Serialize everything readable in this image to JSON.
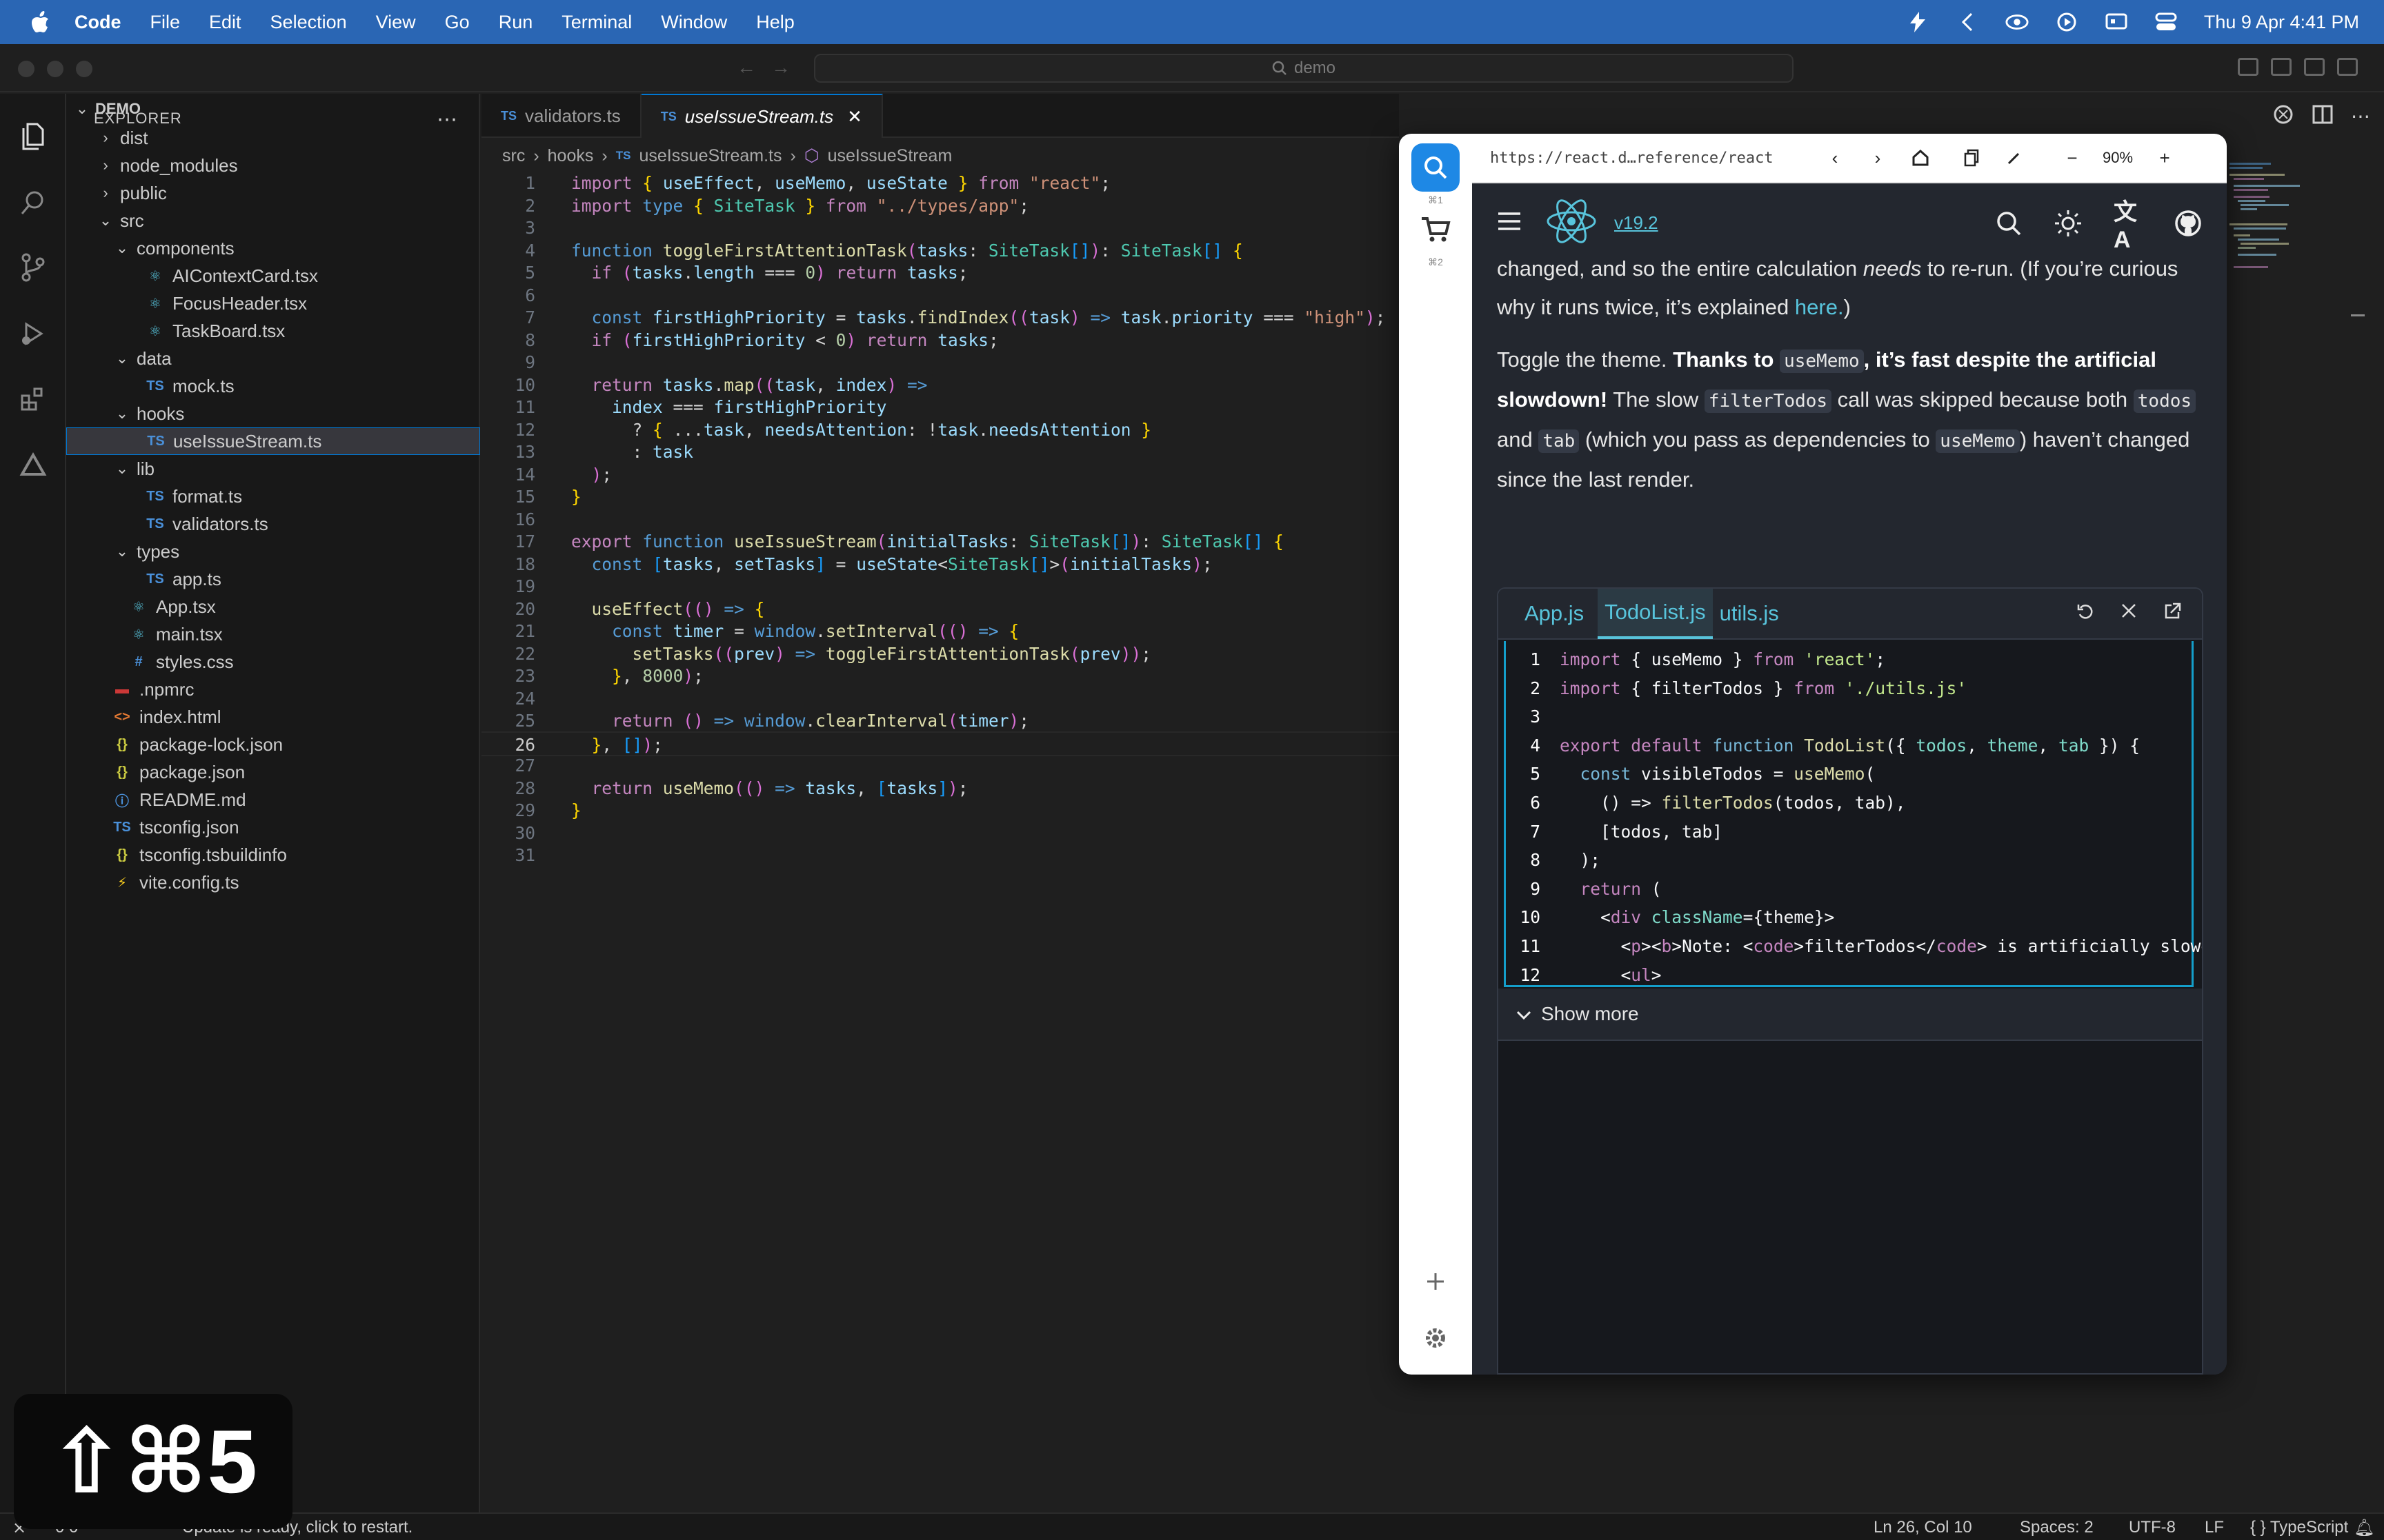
{
  "menubar": {
    "app": "Code",
    "items": [
      "File",
      "Edit",
      "Selection",
      "View",
      "Go",
      "Run",
      "Terminal",
      "Window",
      "Help"
    ],
    "clock": "Thu 9 Apr  4:41 PM"
  },
  "titlebar": {
    "search": "demo"
  },
  "explorer": {
    "title": "EXPLORER",
    "root": "DEMO",
    "tree": [
      {
        "label": "dist",
        "depth": 1,
        "kind": "folder",
        "open": false
      },
      {
        "label": "node_modules",
        "depth": 1,
        "kind": "folder",
        "open": false
      },
      {
        "label": "public",
        "depth": 1,
        "kind": "folder",
        "open": false
      },
      {
        "label": "src",
        "depth": 1,
        "kind": "folder",
        "open": true
      },
      {
        "label": "components",
        "depth": 2,
        "kind": "folder",
        "open": true
      },
      {
        "label": "AIContextCard.tsx",
        "depth": 3,
        "kind": "react"
      },
      {
        "label": "FocusHeader.tsx",
        "depth": 3,
        "kind": "react"
      },
      {
        "label": "TaskBoard.tsx",
        "depth": 3,
        "kind": "react"
      },
      {
        "label": "data",
        "depth": 2,
        "kind": "folder",
        "open": true
      },
      {
        "label": "mock.ts",
        "depth": 3,
        "kind": "ts"
      },
      {
        "label": "hooks",
        "depth": 2,
        "kind": "folder",
        "open": true
      },
      {
        "label": "useIssueStream.ts",
        "depth": 3,
        "kind": "ts",
        "selected": true
      },
      {
        "label": "lib",
        "depth": 2,
        "kind": "folder",
        "open": true
      },
      {
        "label": "format.ts",
        "depth": 3,
        "kind": "ts"
      },
      {
        "label": "validators.ts",
        "depth": 3,
        "kind": "ts"
      },
      {
        "label": "types",
        "depth": 2,
        "kind": "folder",
        "open": true
      },
      {
        "label": "app.ts",
        "depth": 3,
        "kind": "ts"
      },
      {
        "label": "App.tsx",
        "depth": 2,
        "kind": "react"
      },
      {
        "label": "main.tsx",
        "depth": 2,
        "kind": "react"
      },
      {
        "label": "styles.css",
        "depth": 2,
        "kind": "css"
      },
      {
        "label": ".npmrc",
        "depth": 1,
        "kind": "npm"
      },
      {
        "label": "index.html",
        "depth": 1,
        "kind": "html"
      },
      {
        "label": "package-lock.json",
        "depth": 1,
        "kind": "json"
      },
      {
        "label": "package.json",
        "depth": 1,
        "kind": "json"
      },
      {
        "label": "README.md",
        "depth": 1,
        "kind": "info"
      },
      {
        "label": "tsconfig.json",
        "depth": 1,
        "kind": "tsconfig"
      },
      {
        "label": "tsconfig.tsbuildinfo",
        "depth": 1,
        "kind": "json"
      },
      {
        "label": "vite.config.ts",
        "depth": 1,
        "kind": "vite"
      }
    ]
  },
  "tabs": [
    {
      "label": "validators.ts",
      "badge": "TS",
      "active": false
    },
    {
      "label": "useIssueStream.ts",
      "badge": "TS",
      "active": true
    }
  ],
  "breadcrumb": [
    "src",
    "hooks",
    "useIssueStream.ts",
    "useIssueStream"
  ],
  "code": {
    "current_line": 26,
    "lines": [
      "import { useEffect, useMemo, useState } from \"react\";",
      "import type { SiteTask } from \"../types/app\";",
      "",
      "function toggleFirstAttentionTask(tasks: SiteTask[]): SiteTask[] {",
      "  if (tasks.length === 0) return tasks;",
      "",
      "  const firstHighPriority = tasks.findIndex((task) => task.priority === \"high\");",
      "  if (firstHighPriority < 0) return tasks;",
      "",
      "  return tasks.map((task, index) =>",
      "    index === firstHighPriority",
      "      ? { ...task, needsAttention: !task.needsAttention }",
      "      : task",
      "  );",
      "}",
      "",
      "export function useIssueStream(initialTasks: SiteTask[]): SiteTask[] {",
      "  const [tasks, setTasks] = useState<SiteTask[]>(initialTasks);",
      "",
      "  useEffect(() => {",
      "    const timer = window.setInterval(() => {",
      "      setTasks((prev) => toggleFirstAttentionTask(prev));",
      "    }, 8000);",
      "",
      "    return () => window.clearInterval(timer);",
      "  }, []);",
      "",
      "  return useMemo(() => tasks, [tasks]);",
      "}",
      "",
      ""
    ]
  },
  "browser": {
    "url": "https://react.d…reference/react",
    "zoom": "90%",
    "shortcut_1": "⌘1",
    "shortcut_2": "⌘2",
    "version": "v19.2",
    "prose": {
      "p1_a": "changed, and so the entire calculation ",
      "p1_em": "needs",
      "p1_b": " to re-run. (If you’re curious why it runs twice, it’s explained ",
      "p1_link": "here.",
      "p1_c": ")",
      "p2_a": "Toggle the theme. ",
      "p2_bold1": "Thanks to ",
      "p2_code1": "useMemo",
      "p2_bold2": ", it’s fast despite the artificial slowdown!",
      "p2_b": " The slow ",
      "p2_code2": "filterTodos",
      "p2_c": " call was skipped because both ",
      "p2_code3": "todos",
      "p2_d": " and ",
      "p2_code4": "tab",
      "p2_e": " (which you pass as dependencies to ",
      "p2_code5": "useMemo",
      "p2_f": ") haven’t changed since the last render."
    },
    "sandpack": {
      "tabs": [
        "App.js",
        "TodoList.js",
        "utils.js"
      ],
      "active_tab": "TodoList.js",
      "show_more": "Show more",
      "lines": [
        "import { useMemo } from 'react';",
        "import { filterTodos } from './utils.js'",
        "",
        "export default function TodoList({ todos, theme, tab }) {",
        "  const visibleTodos = useMemo(",
        "    () => filterTodos(todos, tab),",
        "    [todos, tab]",
        "  );",
        "  return (",
        "    <div className={theme}>",
        "      <p><b>Note: <code>filterTodos</code> is artificially slowe",
        "      <ul>"
      ]
    }
  },
  "statusbar": {
    "problems": "0  0",
    "update": "Update is ready, click to restart.",
    "position": "Ln 26, Col 10",
    "spaces": "Spaces: 2",
    "encoding": "UTF-8",
    "eol": "LF",
    "language": "{ } TypeScript"
  },
  "overlay": {
    "keys": "⇧⌘5"
  },
  "colors": {
    "accent": "#0078d4",
    "react": "#58c4dc",
    "menubar": "#2a66b4"
  }
}
